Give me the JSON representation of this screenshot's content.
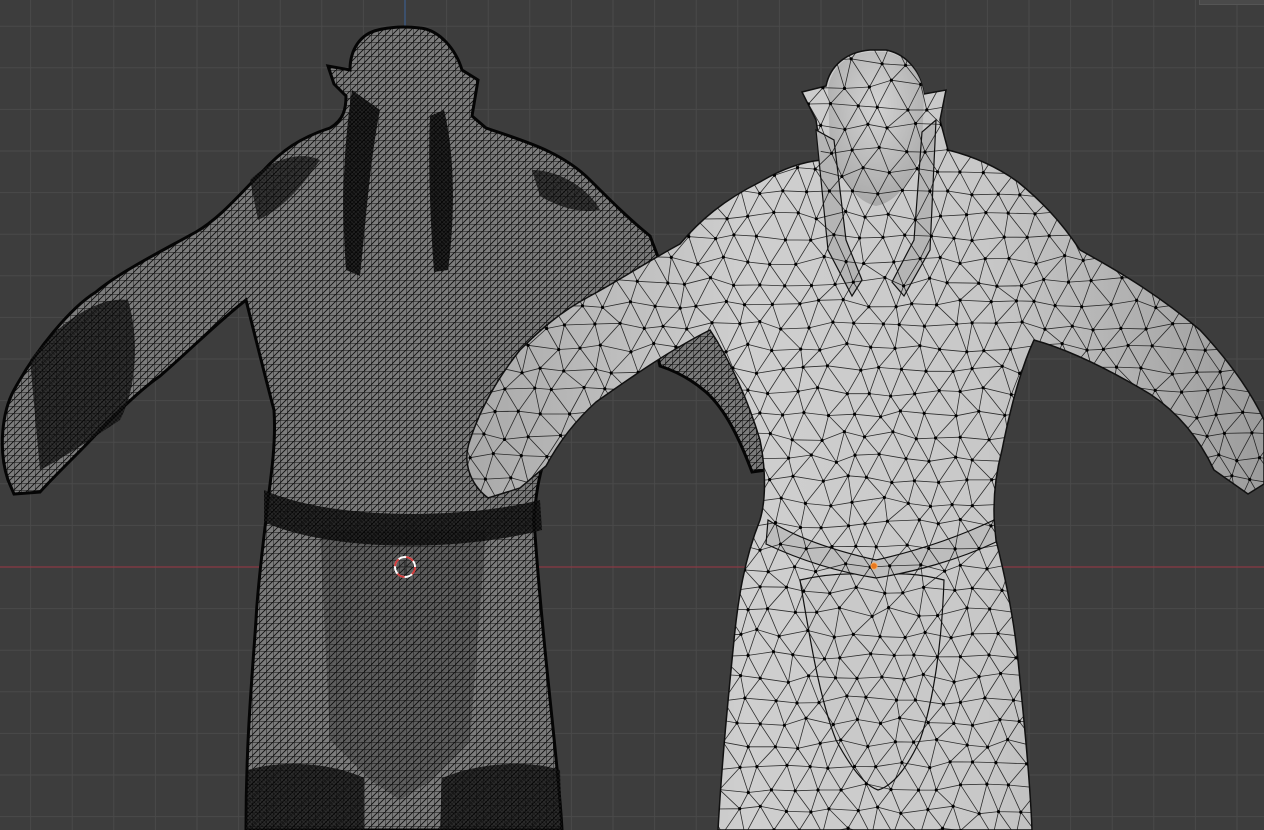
{
  "viewport": {
    "background": "#3d3d3d",
    "grid_minor_color": "#444444",
    "grid_major_color": "#4a4a4a",
    "x_axis_color": "#8a3a44",
    "z_axis_color": "#3d5e8c"
  },
  "objects": [
    {
      "name": "high-poly-orc",
      "shading": "wireframe-overlay",
      "density": "high",
      "surface_color": "#9a9a9a",
      "wire_color": "#0d0d0d"
    },
    {
      "name": "low-poly-orc",
      "shading": "solid-with-edit-vertices",
      "density": "low",
      "surface_color": "#c4c4c4",
      "wire_color": "#111111",
      "vertex_color": "#000000",
      "active_vertex_color": "#e8781e"
    }
  ],
  "cursor_3d": {
    "ring_color_a": "#d23c3c",
    "ring_color_b": "#ffffff"
  }
}
